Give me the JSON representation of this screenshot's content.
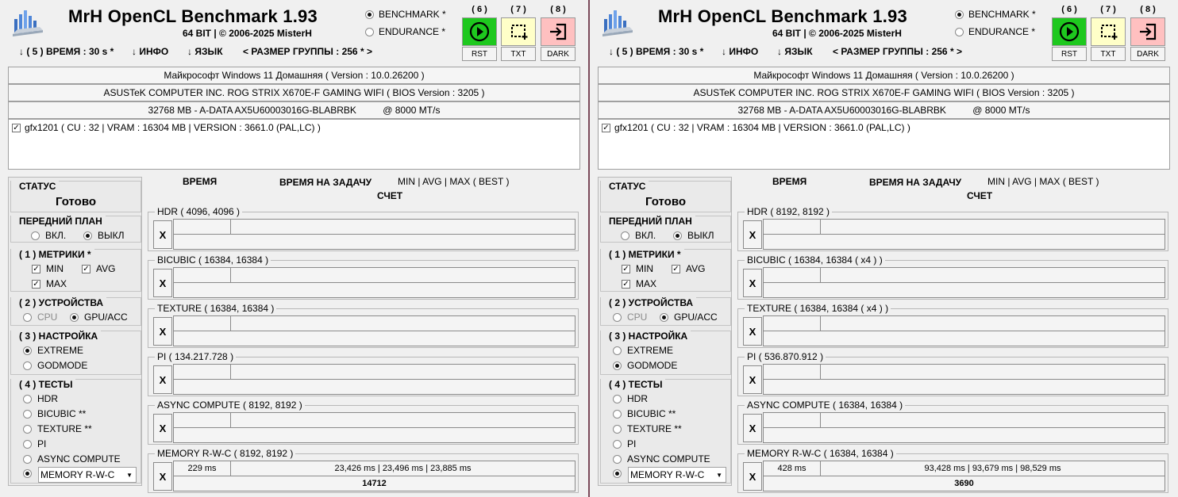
{
  "windows": [
    {
      "title": "MrH OpenCL Benchmark 1.93",
      "subtitle": "64 BIT | ©  2006-2025 MisterH",
      "modes": [
        {
          "label": "BENCHMARK *",
          "selected": true
        },
        {
          "label": "ENDURANCE *",
          "selected": false
        }
      ],
      "buttons": [
        {
          "num": "( 6 )",
          "label": "RST",
          "icon": "play-icon",
          "color": "#1ec81e"
        },
        {
          "num": "( 7 )",
          "label": "TXT",
          "icon": "crop-icon",
          "color": "#ffffc8"
        },
        {
          "num": "( 8 )",
          "label": "DARK",
          "icon": "exit-icon",
          "color": "#ffc0c0"
        }
      ],
      "menu": {
        "time": "↓ ( 5 ) ВРЕМЯ : 30 s *",
        "info": "↓ ИНФО",
        "lang": "↓ ЯЗЫК",
        "group": "< РАЗМЕР ГРУППЫ : 256 * >"
      },
      "sysinfo": {
        "os": "Майкрософт Windows 11 Домашняя ( Version : 10.0.26200 )",
        "board": "ASUSTeK COMPUTER INC. ROG STRIX X670E-F GAMING WIFI ( BIOS Version : 3205 )",
        "ram": "32768 MB - A-DATA AX5U60003016G-BLABRBK          @ 8000 MT/s"
      },
      "gpu": "gfx1201 ( CU : 32 | VRAM : 16304 MB | VERSION : 3661.0 (PAL,LC) )",
      "panel": {
        "status_h": "СТАТУС",
        "status": "Готово",
        "fg_h": "ПЕРЕДНИЙ ПЛАН",
        "fg_on": "ВКЛ.",
        "fg_off": "ВЫКЛ",
        "metrics_h": "( 1 ) МЕТРИКИ *",
        "m_min": "MIN",
        "m_avg": "AVG",
        "m_max": "MAX",
        "dev_h": "( 2 ) УСТРОЙСТВА",
        "cpu": "CPU",
        "gpu": "GPU/ACC",
        "set_h": "( 3 ) НАСТРОЙКА",
        "extreme": "EXTREME",
        "godmode": "GODMODE",
        "setting_selected": "EXTREME",
        "tests_h": "( 4 ) ТЕСТЫ",
        "t_hdr": "HDR",
        "t_bicubic": "BICUBIC **",
        "t_texture": "TEXTURE **",
        "t_pi": "PI",
        "t_async": "ASYNC COMPUTE",
        "t_mem": "MEMORY R-W-C"
      },
      "headers": {
        "time": "ВРЕМЯ",
        "task": "ВРЕМЯ НА ЗАДАЧУ",
        "minmax": "MIN | AVG | MAX ( BEST )",
        "score": "СЧЕТ"
      },
      "tests": [
        {
          "label": "HDR ( 4096, 4096 )",
          "time": "",
          "stats": "",
          "score": ""
        },
        {
          "label": "BICUBIC ( 16384, 16384 )",
          "time": "",
          "stats": "",
          "score": ""
        },
        {
          "label": "TEXTURE ( 16384, 16384 )",
          "time": "",
          "stats": "",
          "score": ""
        },
        {
          "label": "PI ( 134.217.728 )",
          "time": "",
          "stats": "",
          "score": ""
        },
        {
          "label": "ASYNC COMPUTE ( 8192, 8192 )",
          "time": "",
          "stats": "",
          "score": ""
        },
        {
          "label": "MEMORY R-W-C ( 8192, 8192 )",
          "time": "229 ms",
          "stats": "23,426 ms | 23,496 ms | 23,885 ms",
          "score": "14712"
        }
      ],
      "x": "X"
    },
    {
      "title": "MrH OpenCL Benchmark 1.93",
      "subtitle": "64 BIT | ©  2006-2025 MisterH",
      "modes": [
        {
          "label": "BENCHMARK *",
          "selected": true
        },
        {
          "label": "ENDURANCE *",
          "selected": false
        }
      ],
      "buttons": [
        {
          "num": "( 6 )",
          "label": "RST",
          "icon": "play-icon",
          "color": "#1ec81e"
        },
        {
          "num": "( 7 )",
          "label": "TXT",
          "icon": "crop-icon",
          "color": "#ffffc8"
        },
        {
          "num": "( 8 )",
          "label": "DARK",
          "icon": "exit-icon",
          "color": "#ffc0c0"
        }
      ],
      "menu": {
        "time": "↓ ( 5 ) ВРЕМЯ : 30 s *",
        "info": "↓ ИНФО",
        "lang": "↓ ЯЗЫК",
        "group": "< РАЗМЕР ГРУППЫ : 256 * >"
      },
      "sysinfo": {
        "os": "Майкрософт Windows 11 Домашняя ( Version : 10.0.26200 )",
        "board": "ASUSTeK COMPUTER INC. ROG STRIX X670E-F GAMING WIFI ( BIOS Version : 3205 )",
        "ram": "32768 MB - A-DATA AX5U60003016G-BLABRBK          @ 8000 MT/s"
      },
      "gpu": "gfx1201 ( CU : 32 | VRAM : 16304 MB | VERSION : 3661.0 (PAL,LC) )",
      "panel": {
        "status_h": "СТАТУС",
        "status": "Готово",
        "fg_h": "ПЕРЕДНИЙ ПЛАН",
        "fg_on": "ВКЛ.",
        "fg_off": "ВЫКЛ",
        "metrics_h": "( 1 ) МЕТРИКИ *",
        "m_min": "MIN",
        "m_avg": "AVG",
        "m_max": "MAX",
        "dev_h": "( 2 ) УСТРОЙСТВА",
        "cpu": "CPU",
        "gpu": "GPU/ACC",
        "set_h": "( 3 ) НАСТРОЙКА",
        "extreme": "EXTREME",
        "godmode": "GODMODE",
        "setting_selected": "GODMODE",
        "tests_h": "( 4 ) ТЕСТЫ",
        "t_hdr": "HDR",
        "t_bicubic": "BICUBIC **",
        "t_texture": "TEXTURE **",
        "t_pi": "PI",
        "t_async": "ASYNC COMPUTE",
        "t_mem": "MEMORY R-W-C"
      },
      "headers": {
        "time": "ВРЕМЯ",
        "task": "ВРЕМЯ НА ЗАДАЧУ",
        "minmax": "MIN | AVG | MAX ( BEST )",
        "score": "СЧЕТ"
      },
      "tests": [
        {
          "label": "HDR ( 8192, 8192 )",
          "time": "",
          "stats": "",
          "score": ""
        },
        {
          "label": "BICUBIC ( 16384, 16384 ( x4 ) )",
          "time": "",
          "stats": "",
          "score": ""
        },
        {
          "label": "TEXTURE ( 16384, 16384 ( x4 ) )",
          "time": "",
          "stats": "",
          "score": ""
        },
        {
          "label": "PI ( 536.870.912 )",
          "time": "",
          "stats": "",
          "score": ""
        },
        {
          "label": "ASYNC COMPUTE ( 16384, 16384 )",
          "time": "",
          "stats": "",
          "score": ""
        },
        {
          "label": "MEMORY R-W-C ( 16384, 16384 )",
          "time": "428 ms",
          "stats": "93,428 ms | 93,679 ms | 98,529 ms",
          "score": "3690"
        }
      ],
      "x": "X"
    }
  ]
}
